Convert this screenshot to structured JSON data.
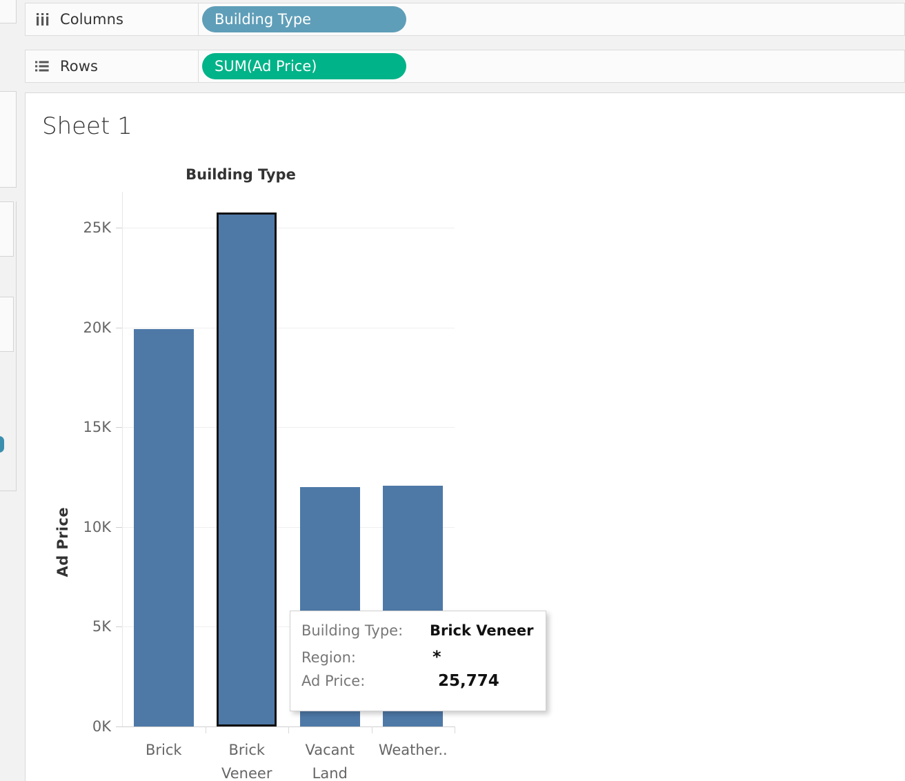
{
  "shelves": [
    {
      "name": "columns",
      "label": "Columns",
      "icon": "columns-icon",
      "pill": {
        "text": "Building Type",
        "kind": "dimension",
        "color": "#5f9eb8"
      }
    },
    {
      "name": "rows",
      "label": "Rows",
      "icon": "rows-icon",
      "pill": {
        "text": "SUM(Ad Price)",
        "kind": "measure",
        "color": "#00b388"
      }
    }
  ],
  "worksheet": {
    "sheet_title": "Sheet 1",
    "column_header_caption": "Building Type"
  },
  "tooltip": {
    "rows": [
      {
        "key": "Building Type:",
        "value": "Brick Veneer"
      },
      {
        "key": "Region:",
        "value": "*"
      },
      {
        "key": "Ad Price:",
        "value": "25,774"
      }
    ]
  },
  "chart_data": {
    "type": "bar",
    "title": "Building Type",
    "xlabel": "",
    "ylabel": "Ad Price",
    "categories": [
      "Brick",
      "Brick Veneer",
      "Vacant Land",
      "Weather.."
    ],
    "values": [
      19930,
      25774,
      12000,
      12076
    ],
    "ytick_labels": [
      "0K",
      "5K",
      "10K",
      "15K",
      "20K",
      "25K"
    ],
    "ytick_values": [
      0,
      5000,
      10000,
      15000,
      20000,
      25000
    ],
    "ylim": [
      0,
      26800
    ],
    "grid": true,
    "legend": "none",
    "bar_color": "#4e79a7",
    "selected_category": "Brick Veneer",
    "selection_outline_color": "#111111",
    "occluded_by_tooltip": [
      "Vacant Land"
    ]
  }
}
